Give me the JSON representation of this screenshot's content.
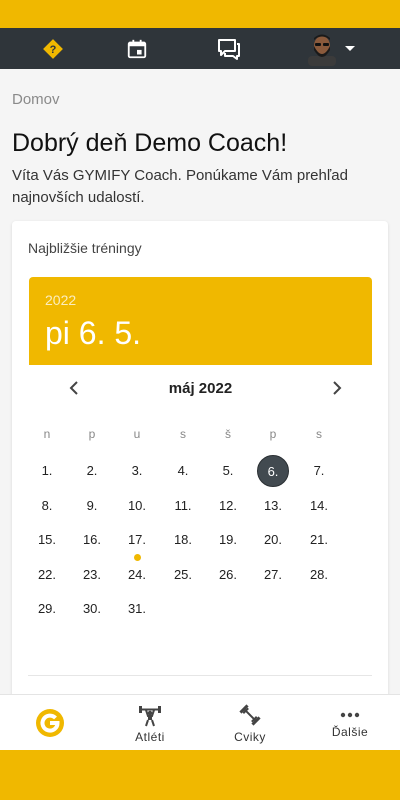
{
  "colors": {
    "accent": "#f0b800",
    "topbar": "#2f353a",
    "selected_day": "#424a50",
    "background": "#f5f5f5"
  },
  "topbar": {
    "icons": [
      "help-icon",
      "calendar-icon",
      "chat-icon",
      "avatar",
      "dropdown-arrow-icon"
    ]
  },
  "breadcrumb": "Domov",
  "greeting": "Dobrý deň Demo Coach!",
  "welcome": "Víta Vás GYMIFY Coach. Ponúkame Vám prehľad najnovších udalostí.",
  "card": {
    "title": "Najbližšie tréningy",
    "selected_year": "2022",
    "selected_date": "pi 6. 5."
  },
  "calendar": {
    "month_label": "máj 2022",
    "weekdays": [
      "n",
      "p",
      "u",
      "s",
      "š",
      "p",
      "s"
    ],
    "weeks": [
      [
        "1.",
        "2.",
        "3.",
        "4.",
        "5.",
        "6.",
        "7."
      ],
      [
        "8.",
        "9.",
        "10.",
        "11.",
        "12.",
        "13.",
        "14."
      ],
      [
        "15.",
        "16.",
        "17.",
        "18.",
        "19.",
        "20.",
        "21."
      ],
      [
        "22.",
        "23.",
        "24.",
        "25.",
        "26.",
        "27.",
        "28."
      ],
      [
        "29.",
        "30.",
        "31.",
        "",
        "",
        "",
        ""
      ]
    ],
    "selected_day": "6.",
    "event_days": [
      "17."
    ]
  },
  "bottom_nav": {
    "home": {
      "icon": "gymify-logo-icon"
    },
    "athletes": {
      "label": "Atléti",
      "icon": "weightlifter-icon"
    },
    "exercises": {
      "label": "Cviky",
      "icon": "dumbbell-icon"
    },
    "more": {
      "label": "Ďalšie",
      "icon": "more-dots-icon"
    }
  }
}
